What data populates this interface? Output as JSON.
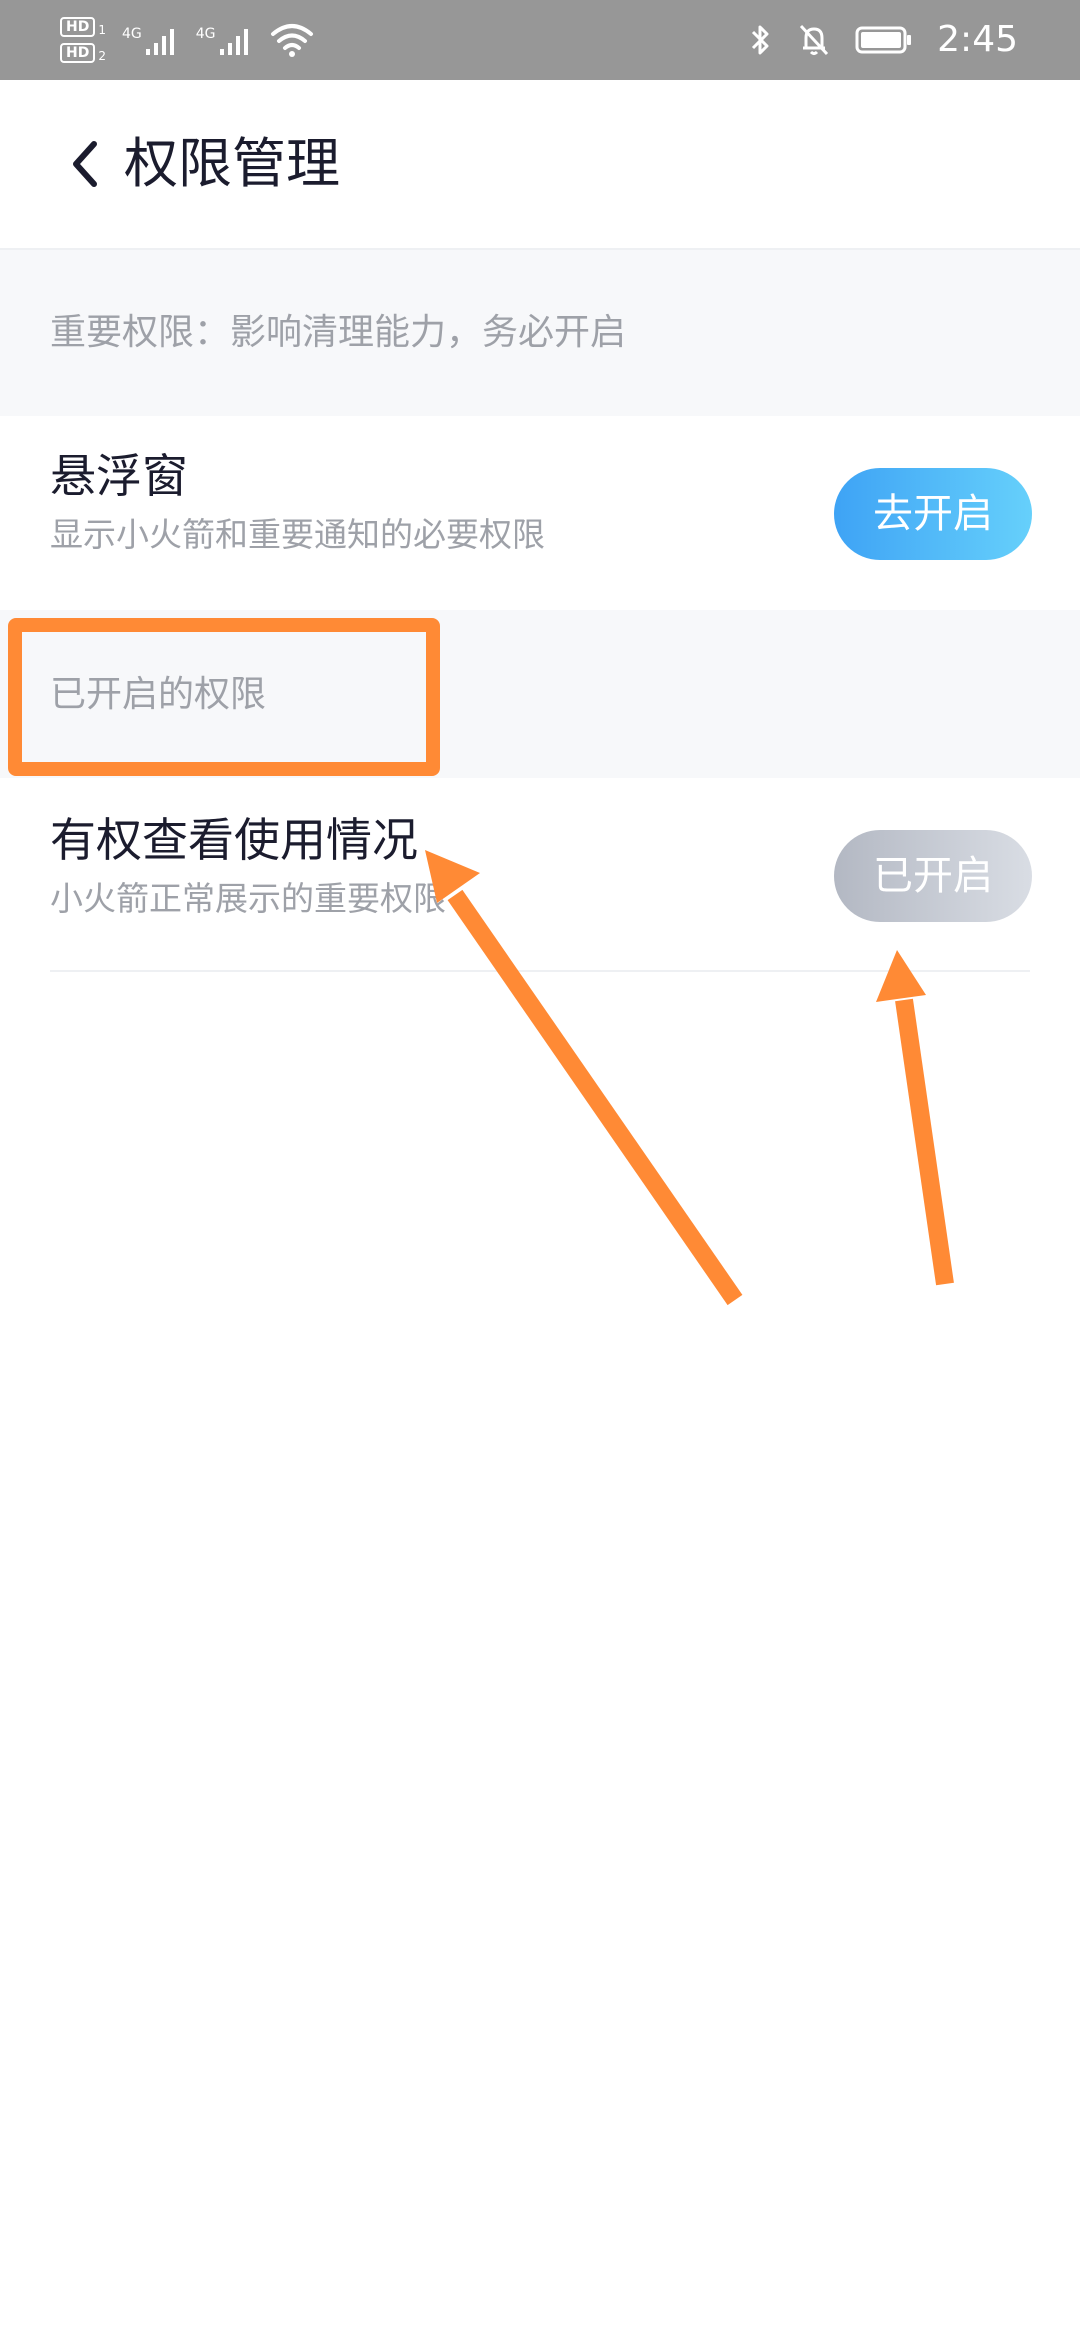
{
  "status_bar": {
    "sim1_badge": "HD",
    "sim1_index": "1",
    "sim2_badge": "HD",
    "sim2_index": "2",
    "net1_label": "4G",
    "net2_label": "4G",
    "time": "2:45",
    "icons": [
      "bluetooth-icon",
      "mute-bell-icon",
      "battery-icon",
      "wifi-icon",
      "signal-icon"
    ]
  },
  "header": {
    "title": "权限管理",
    "back_icon": "chevron-left-icon"
  },
  "sections": [
    {
      "title": "重要权限：影响清理能力，务必开启",
      "items": [
        {
          "title": "悬浮窗",
          "desc": "显示小火箭和重要通知的必要权限",
          "button": "去开启"
        }
      ]
    },
    {
      "title": "已开启的权限",
      "items": [
        {
          "title": "有权查看使用情况",
          "desc": "小火箭正常展示的重要权限",
          "button": "已开启"
        }
      ]
    }
  ],
  "colors": {
    "annotation": "#ff8a35",
    "enable_button_start": "#3ea3f5",
    "enable_button_end": "#66d0fb",
    "enabled_button_start": "#b3b8c3",
    "enabled_button_end": "#d9dde4",
    "section_bg": "#f7f8fa"
  }
}
